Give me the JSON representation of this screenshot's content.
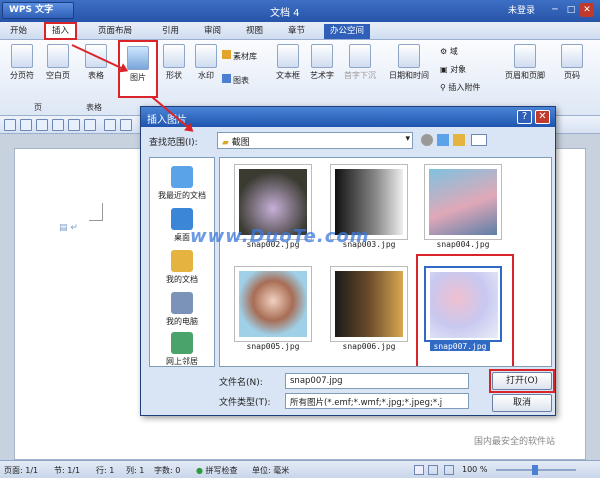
{
  "app": {
    "name": "WPS 文字",
    "doc_title": "文档 4",
    "login": "未登录"
  },
  "menu": [
    "开始",
    "插入",
    "页面布局",
    "引用",
    "审阅",
    "视图",
    "章节",
    "办公空间"
  ],
  "ribbon": {
    "buttons": [
      "分页符",
      "空白页",
      "表格",
      "图片",
      "形状",
      "水印",
      "文本框",
      "艺术字",
      "首字下沉",
      "日期和时间",
      "页眉和页脚",
      "页码"
    ],
    "small": [
      "素材库",
      "图表",
      "域",
      "对象",
      "插入附件"
    ],
    "groups": [
      "页",
      "表格"
    ]
  },
  "status": {
    "page": "页面: 1/1",
    "section": "节: 1/1",
    "row": "行: 1",
    "col": "列: 1",
    "words": "字数: 0",
    "spell": "拼写检查",
    "unit": "单位: 毫米",
    "zoom": "100 %"
  },
  "dialog": {
    "title": "插入图片",
    "look_label": "查找范围(I):",
    "look_value": "截图",
    "places": [
      "我最近的文档",
      "桌面",
      "我的文档",
      "我的电脑",
      "网上邻居"
    ],
    "files": [
      "snap002.jpg",
      "snap003.jpg",
      "snap004.jpg",
      "snap005.jpg",
      "snap006.jpg",
      "snap007.jpg"
    ],
    "filename_label": "文件名(N):",
    "filename_value": "snap007.jpg",
    "filetype_label": "文件类型(T):",
    "filetype_value": "所有图片(*.emf;*.wmf;*.jpg;*.jpeg;*.j",
    "open": "打开(O)",
    "cancel": "取消"
  },
  "watermark": "www.DuoTe.com",
  "watermark2": "国内最安全的软件站",
  "colors": {
    "highlight": "#d9252a",
    "title": "#2754a8",
    "selection": "#316ac5"
  }
}
